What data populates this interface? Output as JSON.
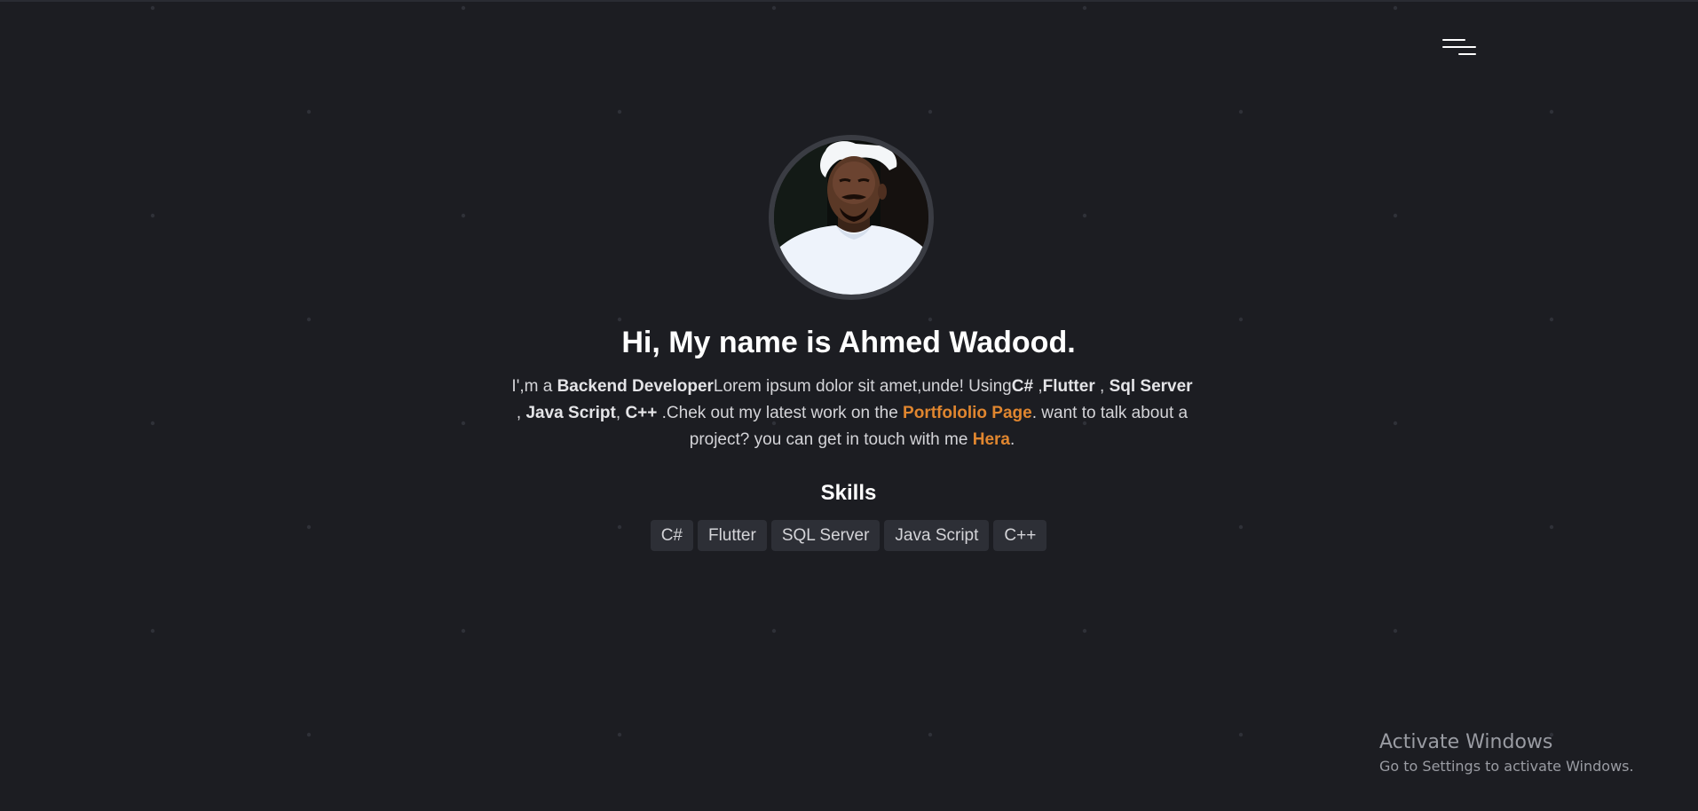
{
  "colors": {
    "background": "#1c1d22",
    "accent": "#e0862f",
    "chip_background": "#2d2f36",
    "text_muted": "#d4d4d8"
  },
  "header": {
    "menu_icon": "menu-icon"
  },
  "profile": {
    "avatar_icon": "profile-photo"
  },
  "hero": {
    "heading": "Hi, My name is Ahmed Wadood.",
    "bio": {
      "intro": "I',m a ",
      "role": "Backend Developer",
      "lorem": "Lorem ipsum dolor sit amet,unde! Using",
      "tech1": "C#",
      "sep1": " ,",
      "tech2": "Flutter",
      "sep2": " , ",
      "tech3": "Sql Server",
      "sep3": " , ",
      "tech4": "Java Script",
      "sep4": ", ",
      "tech5": "C++",
      "mid": " .Chek out my latest work on the ",
      "portfolio_link": "Portfololio Page",
      "after_link": ". want to talk about a project? you can get in touch with me ",
      "contact_link": "Hera",
      "end": "."
    }
  },
  "skills": {
    "title": "Skills",
    "items": [
      "C#",
      "Flutter",
      "SQL Server",
      "Java Script",
      "C++"
    ]
  },
  "watermark": {
    "title": "Activate Windows",
    "subtitle": "Go to Settings to activate Windows."
  }
}
